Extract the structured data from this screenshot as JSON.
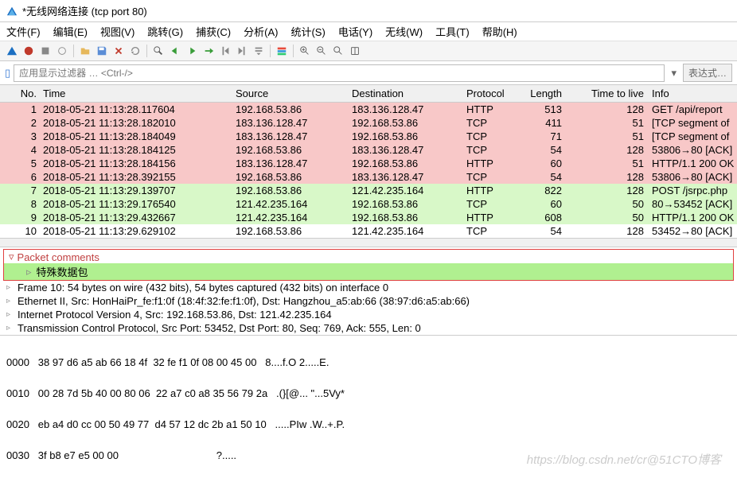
{
  "window": {
    "title": "*无线网络连接 (tcp port 80)"
  },
  "menu": {
    "file": "文件(F)",
    "edit": "编辑(E)",
    "view": "视图(V)",
    "go": "跳转(G)",
    "capture": "捕获(C)",
    "analyze": "分析(A)",
    "statistics": "统计(S)",
    "telephony": "电话(Y)",
    "wireless": "无线(W)",
    "tools": "工具(T)",
    "help": "帮助(H)"
  },
  "filter": {
    "placeholder": "应用显示过滤器 … <Ctrl-/>",
    "expr": "表达式…"
  },
  "columns": {
    "no": "No.",
    "time": "Time",
    "source": "Source",
    "destination": "Destination",
    "protocol": "Protocol",
    "length": "Length",
    "ttl": "Time to live",
    "info": "Info"
  },
  "packets": [
    {
      "no": "1",
      "time": "2018-05-21 11:13:28.117604",
      "src": "192.168.53.86",
      "dst": "183.136.128.47",
      "proto": "HTTP",
      "len": "513",
      "ttl": "128",
      "info": "GET /api/report",
      "bg": "pink"
    },
    {
      "no": "2",
      "time": "2018-05-21 11:13:28.182010",
      "src": "183.136.128.47",
      "dst": "192.168.53.86",
      "proto": "TCP",
      "len": "411",
      "ttl": "51",
      "info": "[TCP segment of",
      "bg": "pink"
    },
    {
      "no": "3",
      "time": "2018-05-21 11:13:28.184049",
      "src": "183.136.128.47",
      "dst": "192.168.53.86",
      "proto": "TCP",
      "len": "71",
      "ttl": "51",
      "info": "[TCP segment of",
      "bg": "pink"
    },
    {
      "no": "4",
      "time": "2018-05-21 11:13:28.184125",
      "src": "192.168.53.86",
      "dst": "183.136.128.47",
      "proto": "TCP",
      "len": "54",
      "ttl": "128",
      "info": "53806→80 [ACK]",
      "bg": "pink"
    },
    {
      "no": "5",
      "time": "2018-05-21 11:13:28.184156",
      "src": "183.136.128.47",
      "dst": "192.168.53.86",
      "proto": "HTTP",
      "len": "60",
      "ttl": "51",
      "info": "HTTP/1.1 200 OK",
      "bg": "pink"
    },
    {
      "no": "6",
      "time": "2018-05-21 11:13:28.392155",
      "src": "192.168.53.86",
      "dst": "183.136.128.47",
      "proto": "TCP",
      "len": "54",
      "ttl": "128",
      "info": "53806→80 [ACK]",
      "bg": "pink"
    },
    {
      "no": "7",
      "time": "2018-05-21 11:13:29.139707",
      "src": "192.168.53.86",
      "dst": "121.42.235.164",
      "proto": "HTTP",
      "len": "822",
      "ttl": "128",
      "info": "POST /jsrpc.php",
      "bg": "green"
    },
    {
      "no": "8",
      "time": "2018-05-21 11:13:29.176540",
      "src": "121.42.235.164",
      "dst": "192.168.53.86",
      "proto": "TCP",
      "len": "60",
      "ttl": "50",
      "info": "80→53452 [ACK]",
      "bg": "green"
    },
    {
      "no": "9",
      "time": "2018-05-21 11:13:29.432667",
      "src": "121.42.235.164",
      "dst": "192.168.53.86",
      "proto": "HTTP",
      "len": "608",
      "ttl": "50",
      "info": "HTTP/1.1 200 OK",
      "bg": "green"
    },
    {
      "no": "10",
      "time": "2018-05-21 11:13:29.629102",
      "src": "192.168.53.86",
      "dst": "121.42.235.164",
      "proto": "TCP",
      "len": "54",
      "ttl": "128",
      "info": "53452→80 [ACK]",
      "bg": "white"
    }
  ],
  "details": {
    "comments_title": "Packet comments",
    "special": "特殊数据包",
    "frame": "Frame 10: 54 bytes on wire (432 bits), 54 bytes captured (432 bits) on interface 0",
    "eth": "Ethernet II, Src: HonHaiPr_fe:f1:0f (18:4f:32:fe:f1:0f), Dst: Hangzhou_a5:ab:66 (38:97:d6:a5:ab:66)",
    "ip": "Internet Protocol Version 4, Src: 192.168.53.86, Dst: 121.42.235.164",
    "tcp": "Transmission Control Protocol, Src Port: 53452, Dst Port: 80, Seq: 769, Ack: 555, Len: 0"
  },
  "hex": {
    "l0": "0000   38 97 d6 a5 ab 66 18 4f  32 fe f1 0f 08 00 45 00   8....f.O 2.....E.",
    "l1": "0010   00 28 7d 5b 40 00 80 06  22 a7 c0 a8 35 56 79 2a   .(}[@... \"...5Vy*",
    "l2": "0020   eb a4 d0 cc 00 50 49 77  d4 57 12 dc 2b a1 50 10   .....PIw .W..+.P.",
    "l3": "0030   3f b8 e7 e5 00 00                                  ?....."
  },
  "watermark": "https://blog.csdn.net/cr@51CTO博客"
}
